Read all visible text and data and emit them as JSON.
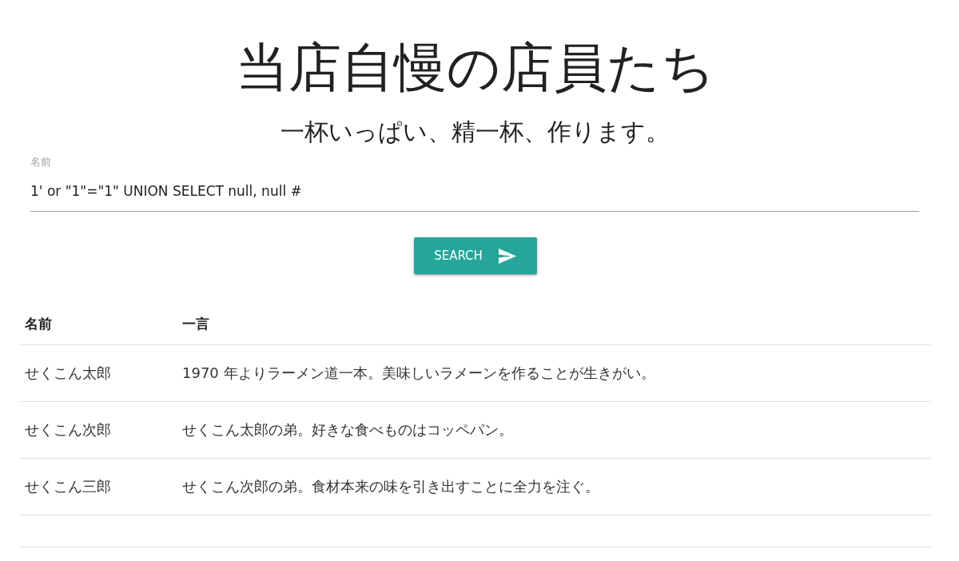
{
  "header": {
    "title": "当店自慢の店員たち",
    "subtitle": "一杯いっぱい、精一杯、作ります。"
  },
  "search_form": {
    "field": {
      "label": "名前",
      "value": "1' or \"1\"=\"1\" UNION SELECT null, null #"
    },
    "button": {
      "label": "SEARCH"
    }
  },
  "table": {
    "columns": [
      "名前",
      "一言"
    ],
    "rows": [
      {
        "name": "せくこん太郎",
        "comment": "1970 年よりラーメン道一本。美味しいラメーンを作ることが生きがい。"
      },
      {
        "name": "せくこん次郎",
        "comment": "せくこん太郎の弟。好きな食べものはコッペパン。"
      },
      {
        "name": "せくこん三郎",
        "comment": "せくこん次郎の弟。食材本来の味を引き出すことに全力を注ぐ。"
      }
    ]
  }
}
